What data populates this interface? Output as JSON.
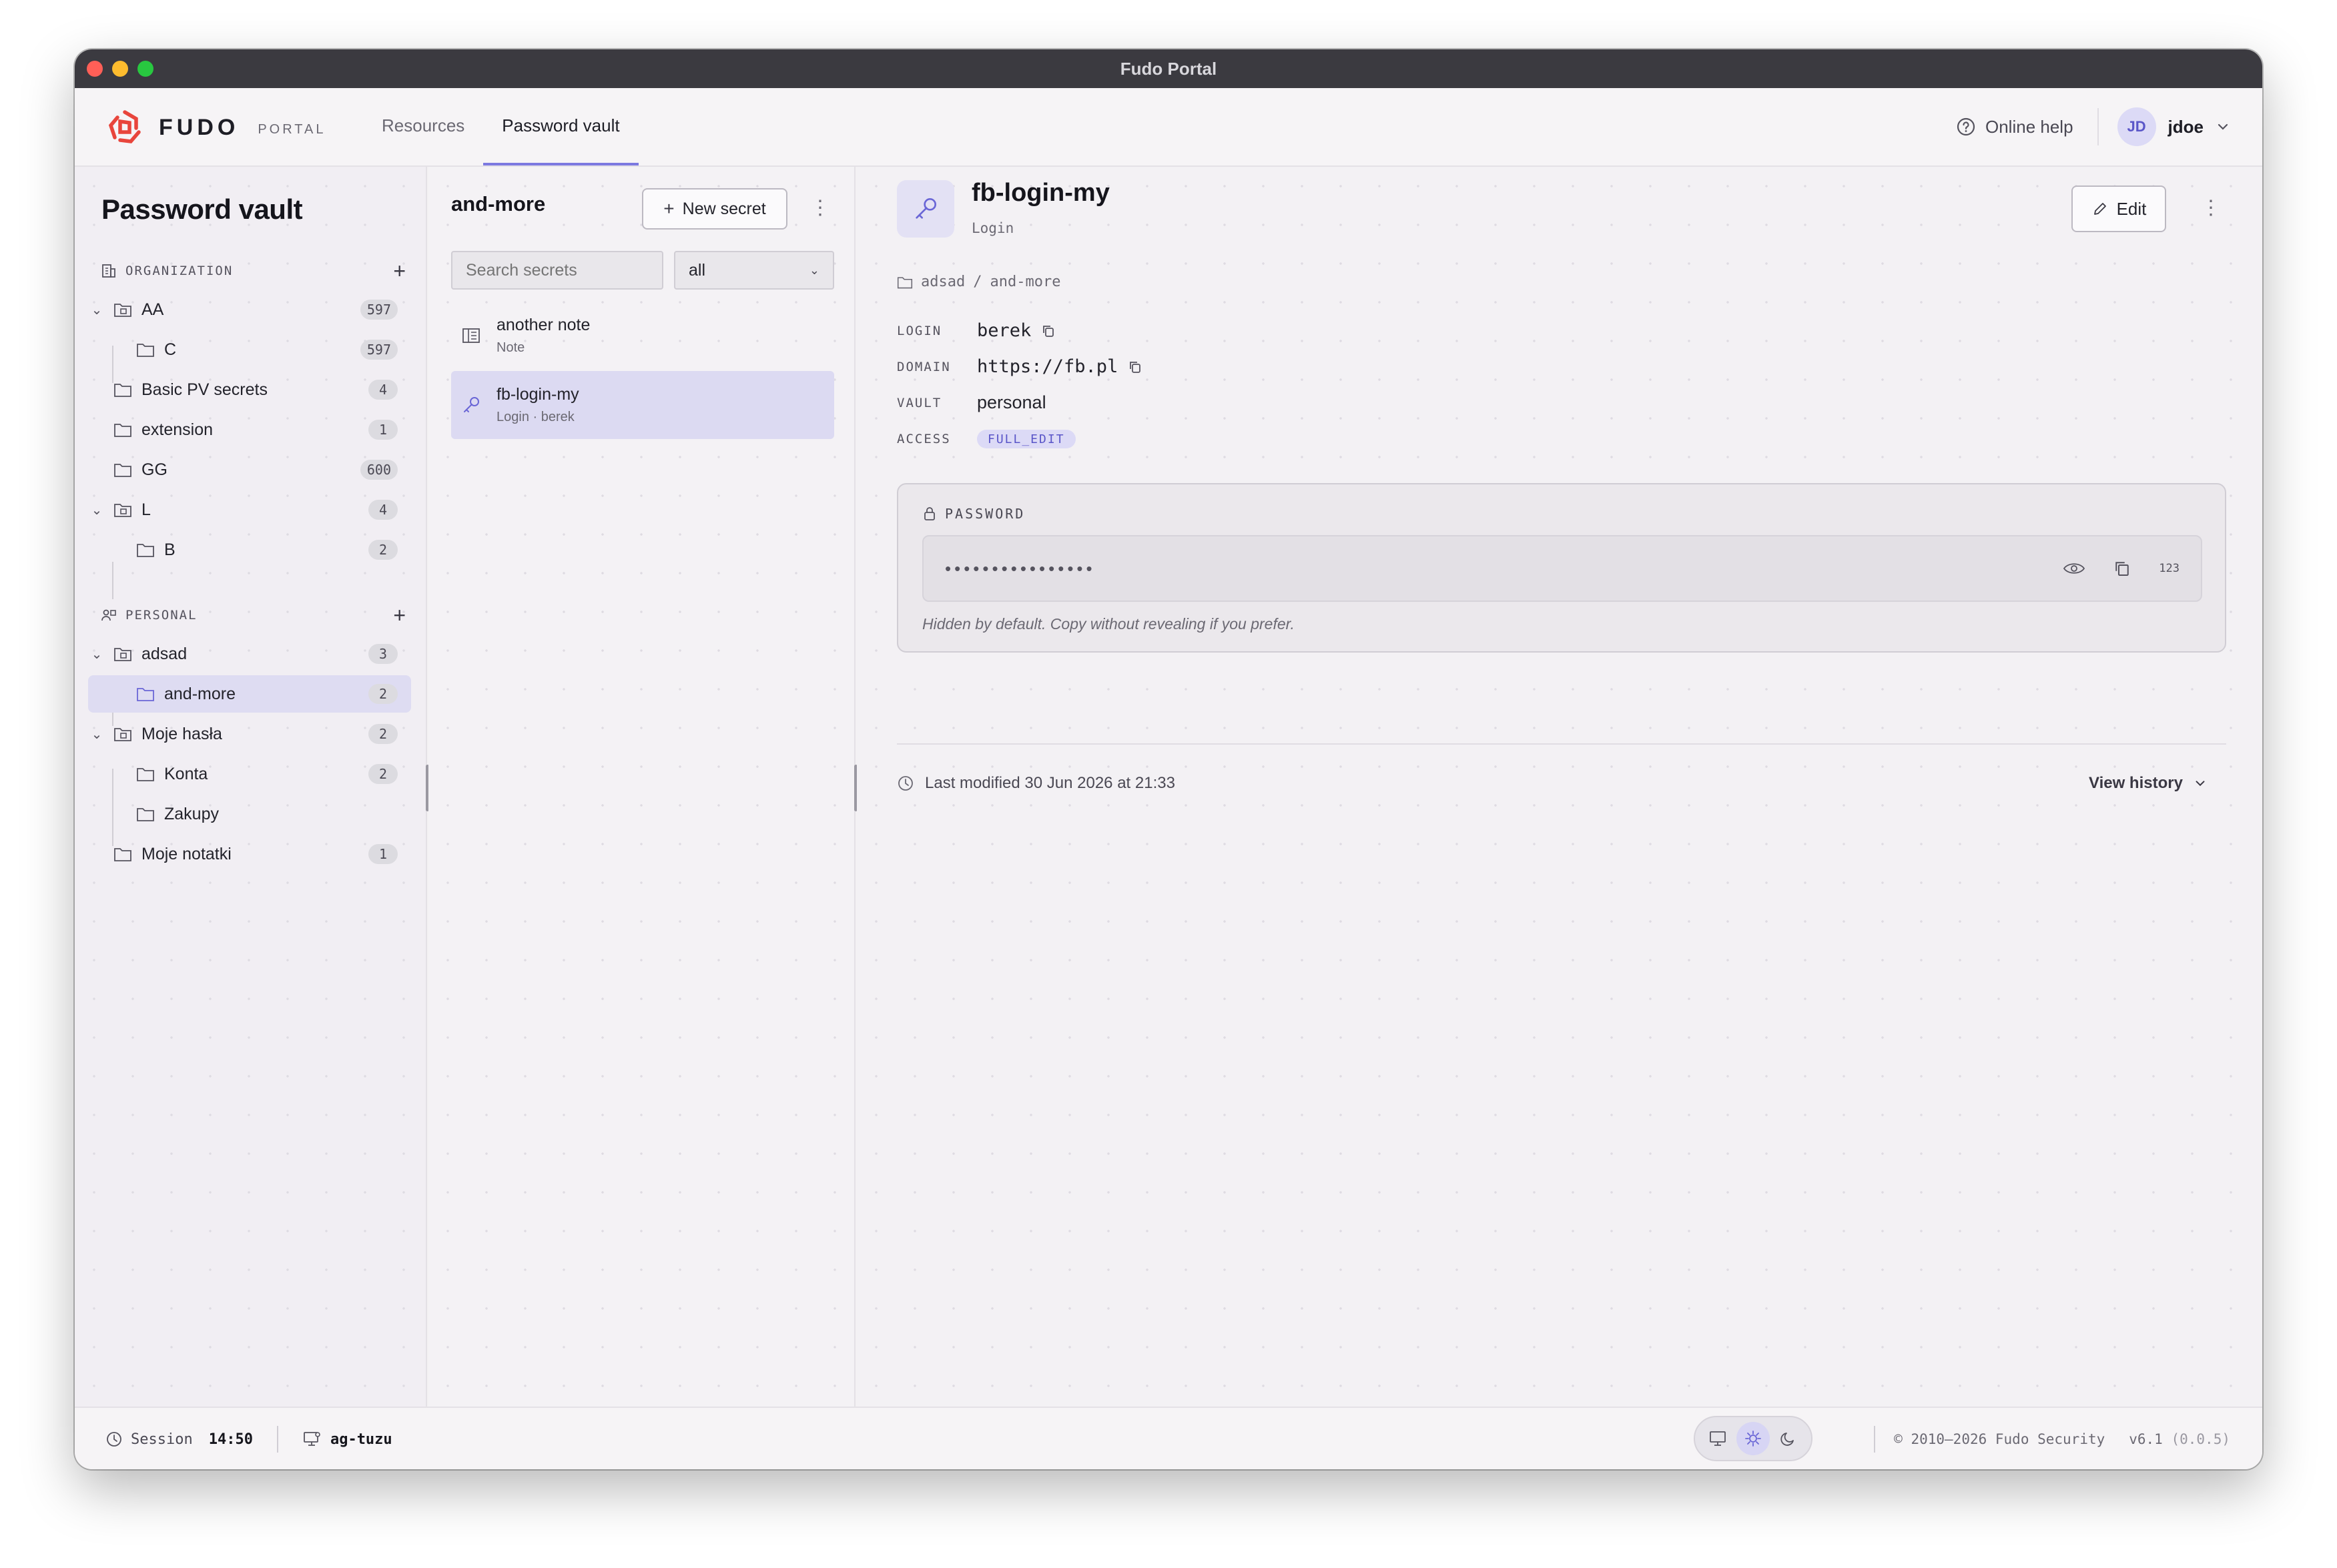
{
  "window": {
    "title": "Fudo Portal",
    "traffic_colors": [
      "#ff5f57",
      "#febc2e",
      "#28c840"
    ]
  },
  "brand": {
    "name": "FUDO",
    "sub": "PORTAL",
    "accent": "#e8453c"
  },
  "nav": {
    "tabs": [
      {
        "label": "Resources",
        "active": false
      },
      {
        "label": "Password vault",
        "active": true
      }
    ]
  },
  "header": {
    "help_label": "Online help",
    "user_initials": "JD",
    "username": "jdoe"
  },
  "sidebar": {
    "title": "Password vault",
    "organization_label": "ORGANIZATION",
    "personal_label": "PERSONAL",
    "add_glyph": "+",
    "org_items": [
      {
        "label": "AA",
        "count": "597",
        "expanded": true
      },
      {
        "label": "C",
        "count": "597"
      },
      {
        "label": "Basic PV secrets",
        "count": "4"
      },
      {
        "label": "extension",
        "count": "1"
      },
      {
        "label": "GG",
        "count": "600"
      },
      {
        "label": "L",
        "count": "4",
        "expanded": true
      },
      {
        "label": "B",
        "count": "2"
      }
    ],
    "personal_items": [
      {
        "label": "adsad",
        "count": "3",
        "expanded": true
      },
      {
        "label": "and-more",
        "count": "2",
        "selected": true
      },
      {
        "label": "Moje hasła",
        "count": "2",
        "expanded": true
      },
      {
        "label": "Konta",
        "count": "2"
      },
      {
        "label": "Zakupy",
        "count": ""
      },
      {
        "label": "Moje notatki",
        "count": "1"
      }
    ]
  },
  "list": {
    "title": "and-more",
    "new_button": "New secret",
    "search_placeholder": "Search secrets",
    "filter_value": "all",
    "items": [
      {
        "title": "another note",
        "sub": "Note",
        "icon": "note-icon"
      },
      {
        "title": "fb-login-my",
        "sub": "Login · berek",
        "icon": "key-icon",
        "selected": true
      }
    ]
  },
  "detail": {
    "title": "fb-login-my",
    "type": "Login",
    "edit_label": "Edit",
    "breadcrumb": [
      "adsad",
      "and-more"
    ],
    "breadcrumb_sep": "/",
    "fields": {
      "login": {
        "label": "LOGIN",
        "value": "berek"
      },
      "domain": {
        "label": "DOMAIN",
        "value": "https://fb.pl"
      },
      "vault": {
        "label": "VAULT",
        "value": "personal"
      },
      "access": {
        "label": "ACCESS",
        "value": "FULL_EDIT"
      }
    },
    "password": {
      "label": "PASSWORD",
      "masked": "••••••••••••••••",
      "numeric_toggle": "123",
      "hint": "Hidden by default. Copy without revealing if you prefer."
    },
    "last_modified": "Last modified 30 Jun 2026 at 21:33",
    "view_history": "View history"
  },
  "footer": {
    "session_label": "Session",
    "session_time": "14:50",
    "host": "ag-tuzu",
    "copyright": "© 2010–2026 Fudo Security",
    "version": "v6.1",
    "build": "(0.0.5)",
    "theme_active": "light"
  }
}
